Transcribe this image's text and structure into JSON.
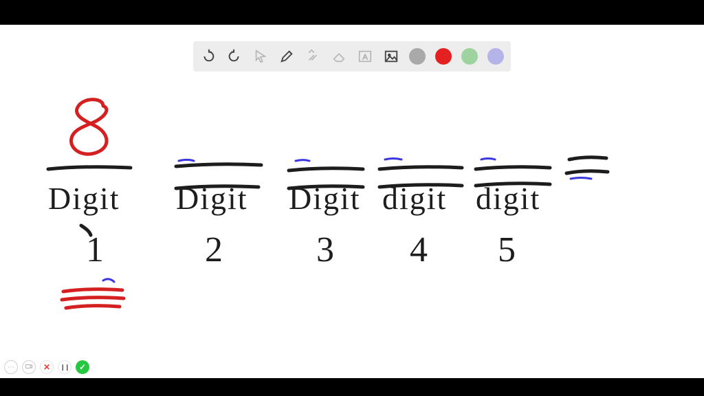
{
  "toolbar": {
    "icons": {
      "undo": "undo-icon",
      "redo": "redo-icon",
      "pointer": "pointer-icon",
      "pen": "pen-icon",
      "tools": "tools-icon",
      "eraser": "eraser-icon",
      "textbox": "textbox-icon",
      "image": "image-icon"
    },
    "colors": {
      "gray": "#a9a9a9",
      "red": "#e42020",
      "green": "#9ed29e",
      "purple": "#b4b4e8"
    },
    "active_tool": "pen",
    "active_color": "red"
  },
  "canvas": {
    "ink_colors": {
      "black": "#1d1d1d",
      "red": "#d42020",
      "blue": "#3a36e0"
    },
    "slots": [
      {
        "label": "Digit",
        "sub": "1",
        "value": "8"
      },
      {
        "label": "Digit",
        "sub": "2",
        "value": ""
      },
      {
        "label": "Digit",
        "sub": "3",
        "value": ""
      },
      {
        "label": "digit",
        "sub": "4",
        "value": ""
      },
      {
        "label": "digit",
        "sub": "5",
        "value": ""
      }
    ],
    "trailing_symbol": "="
  },
  "recording": {
    "buttons": {
      "more": "⋯",
      "camera": "cam",
      "close": "✕",
      "pause": "❙❙",
      "done": "✓"
    }
  }
}
